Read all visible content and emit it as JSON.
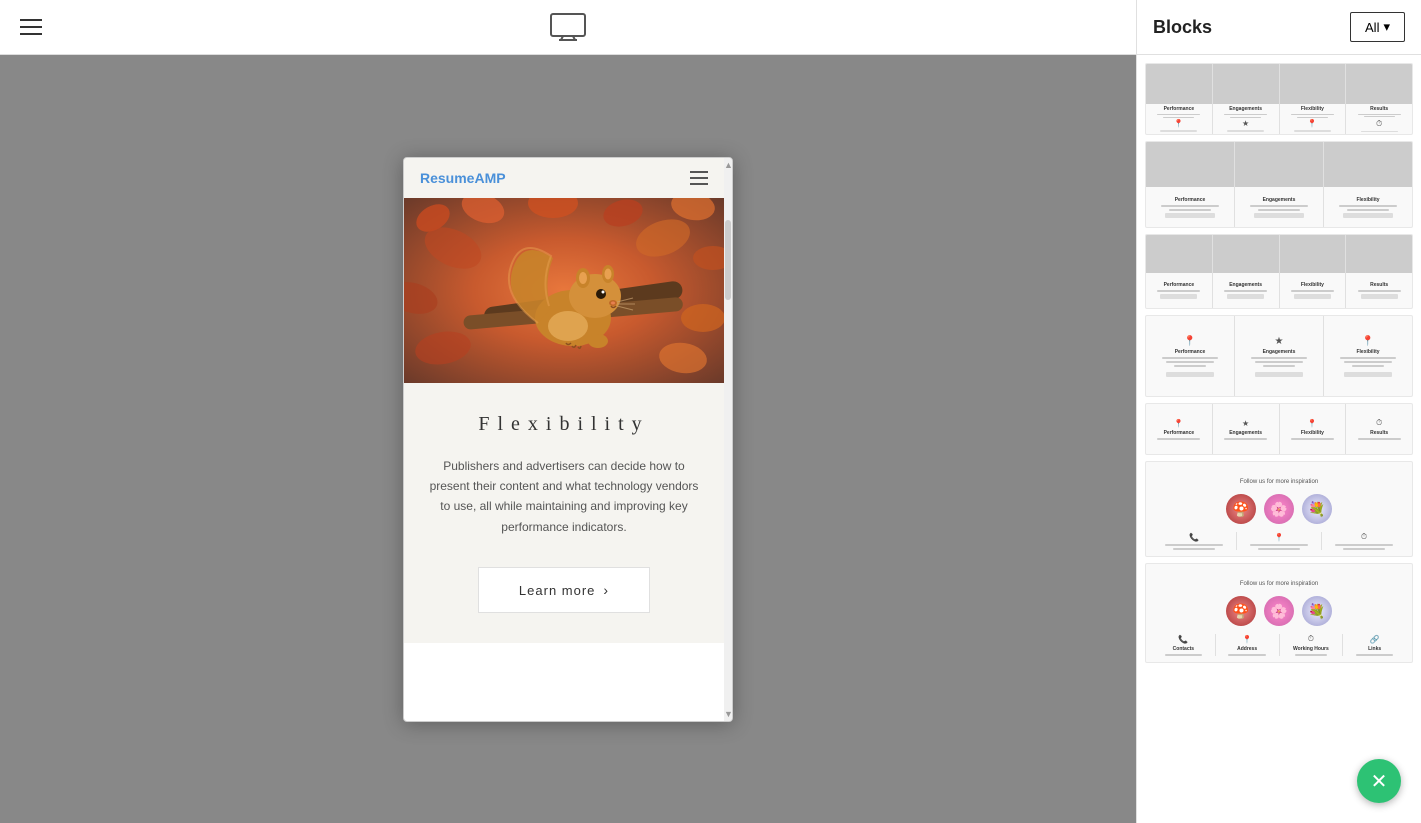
{
  "toolbar": {
    "menu_label": "menu",
    "monitor_label": "monitor"
  },
  "mobile_preview": {
    "logo_text_plain": "Resume",
    "logo_text_accent": "AMP",
    "title": "Flexibility",
    "body_text": "Publishers and advertisers can decide how to present their content and what technology vendors to use, all while maintaining and improving key performance indicators.",
    "learn_more_label": "Learn more"
  },
  "blocks_panel": {
    "title": "Blocks",
    "filter_label": "All",
    "filter_icon": "▾"
  },
  "block_rows": [
    {
      "id": "block-1",
      "type": "4col-img-text"
    },
    {
      "id": "block-2",
      "type": "3col-img-text"
    },
    {
      "id": "block-3",
      "type": "4col-img-text-btn"
    },
    {
      "id": "block-4",
      "type": "3col-icon-text"
    },
    {
      "id": "block-5",
      "type": "4col-icon-text"
    },
    {
      "id": "block-6",
      "type": "contacts-flowers"
    },
    {
      "id": "block-7",
      "type": "contacts-with-4col"
    }
  ]
}
